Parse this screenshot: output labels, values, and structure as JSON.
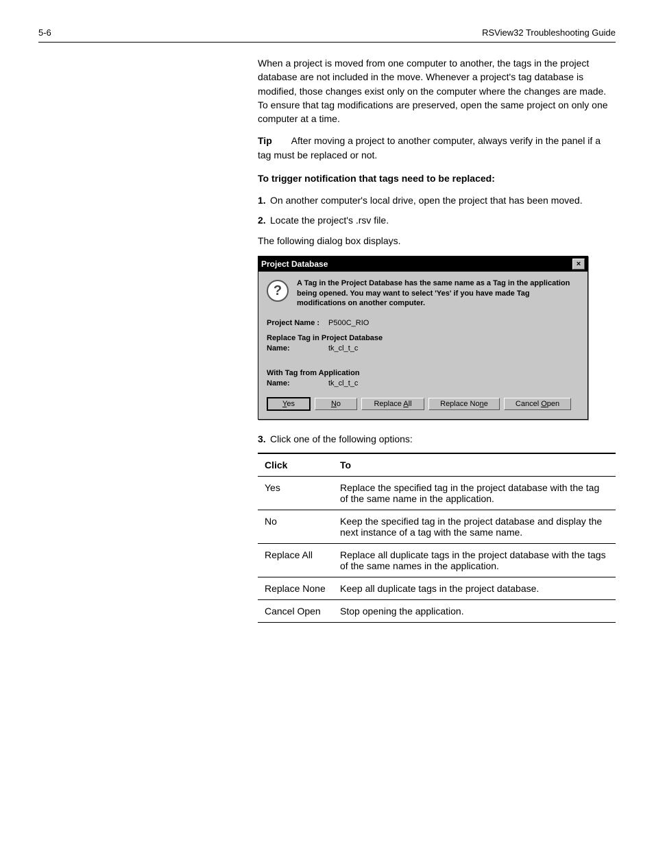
{
  "header": {
    "page_number": "5-6",
    "chapter": "RSView32 Troubleshooting Guide"
  },
  "intro": "When a project is moved from one computer to another, the tags in the project database are not included in the move. Whenever a project's tag database is modified, those changes exist only on the computer where the changes are made. To ensure that tag modifications are preserved, open the same project on only one computer at a time.",
  "tip": {
    "label": "Tip",
    "text": "After moving a project to another computer, always verify in the panel if a tag must be replaced or not."
  },
  "trigger_heading": "To trigger notification that tags need to be replaced:",
  "steps": {
    "s1": "On another computer's local drive, open the project that has been moved.",
    "s2": "Locate the project's .rsv file.",
    "dialog_intro": "The following dialog box displays.",
    "s3": "Click one of the following options:"
  },
  "dialog": {
    "title": "Project Database",
    "message": "A Tag in the Project Database has the same name as a Tag in the application being opened. You may want to select 'Yes' if you have made Tag modifications on another computer.",
    "project_name_label": "Project Name :",
    "project_name_value": "P500C_RIO",
    "replace_heading": "Replace Tag in Project Database",
    "name_label": "Name:",
    "tag1": "tk_cl_t_c",
    "with_heading": "With Tag from Application",
    "tag2": "tk_cl_t_c",
    "buttons": {
      "yes": "Yes",
      "no": "No",
      "replace_all": "Replace All",
      "replace_none": "Replace None",
      "cancel": "Cancel Open"
    }
  },
  "table": {
    "h1": "Click",
    "h2": "To",
    "rows": [
      {
        "c1": "Yes",
        "c2": "Replace the specified tag in the project database with the tag of the same name in the application."
      },
      {
        "c1": "No",
        "c2": "Keep the specified tag in the project database and display the next instance of a tag with the same name."
      },
      {
        "c1": "Replace All",
        "c2": "Replace all duplicate tags in the project database with the tags of the same names in the application."
      },
      {
        "c1": "Replace None",
        "c2": "Keep all duplicate tags in the project database."
      },
      {
        "c1": "Cancel Open",
        "c2": "Stop opening the application."
      }
    ]
  }
}
